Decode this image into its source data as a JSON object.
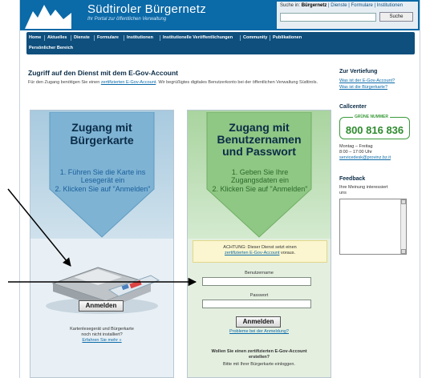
{
  "header": {
    "site_title": "Südtiroler Bürgernetz",
    "site_subtitle": "Ihr Portal zur öffentlichen Verwaltung"
  },
  "search": {
    "label": "Suche in:",
    "scope": "Bürgernetz",
    "links": "| Dienste | Formulare | Institutionen",
    "button_label": "Suche"
  },
  "nav": {
    "items": [
      "Home",
      "Aktuelles",
      "Dienste",
      "Formulare",
      "Institutionen",
      "Institutionelle Veröffentlichungen",
      "Community",
      "Publikationen"
    ],
    "row2": "Persönlicher Bereich"
  },
  "main": {
    "title": "Zugriff auf den Dienst mit dem E-Gov-Account",
    "intro_before": "Für den Zugang benötigen Sie einen ",
    "intro_link": "zertifizierten E-Gov-Account",
    "intro_after": ". Wir begrüßigtes digitales Benutzerkonto bei der öffentlichen Verwaltung Südtirols."
  },
  "card_left": {
    "title_line1": "Zugang mit",
    "title_line2": "Bürgerkarte",
    "step1": "1. Führen Sie die Karte ins",
    "step1b": "Lesegerät ein",
    "step2": "2. Klicken Sie auf \"Anmelden\"",
    "login_button": "Anmelden",
    "note_line1": "Kartenlesegerät und Bürgerkarte",
    "note_line2": "noch nicht installiert?",
    "note_link": "Erfahren Sie mehr »"
  },
  "card_right": {
    "title_line1": "Zugang mit",
    "title_line2": "Benutzernamen",
    "title_line3": "und Passwort",
    "step1": "1. Geben Sie Ihre",
    "step1b": "Zugangsdaten ein",
    "step2": "2. Klicken Sie auf \"Anmelden\"",
    "attention_line1": "ACHTUNG: Dieser Dienst setzt einen",
    "attention_link": "zertifizierten E-Gov-Account",
    "attention_line2": "voraus.",
    "username_label": "Benutzername",
    "password_label": "Passwort",
    "login_button": "Anmelden",
    "problem_link": "Probleme bei der Anmeldung?",
    "cert_question_line1": "Wollen Sie einen zertifizierten E-Gov-Account",
    "cert_question_line2": "erstellen?",
    "cert_hint": "Bitte mit Ihrer Bürgerkarte einloggen."
  },
  "sidebar": {
    "deepening_title": "Zur Vertiefung",
    "link1": "Was ist der E-Gov-Account?",
    "link2": "Was ist die Bürgerkarte?",
    "callcenter_title": "Callcenter",
    "hotline_label": "GRÜNE NUMMER",
    "hotline_number": "800 816 836",
    "hours_line1": "Montag – Freitag",
    "hours_line2": "8:00 – 17:00 Uhr",
    "email": "servicedesk@provinz.bz.it",
    "feedback_title": "Feedback",
    "feedback_line1": "Ihre Meinung interessiert",
    "feedback_line2": "uns"
  },
  "colors": {
    "header_blue": "#0b6aa8",
    "nav_blue": "#0e4f7d",
    "hotline_green": "#2e8b2e"
  }
}
